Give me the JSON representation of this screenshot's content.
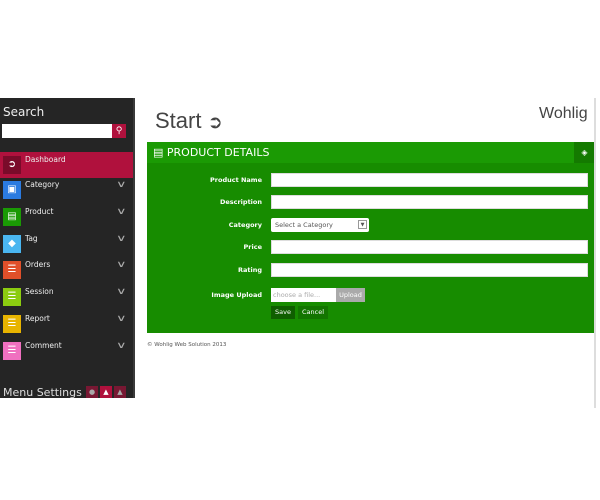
{
  "sidebar": {
    "search_label": "Search",
    "search_placeholder": "",
    "items": [
      {
        "label": "Dashboard",
        "icon": "arrow-circle-icon",
        "color": "#7a0b2a",
        "active": true
      },
      {
        "label": "Category",
        "icon": "cube-icon",
        "color": "#2b7be0"
      },
      {
        "label": "Product",
        "icon": "list-icon",
        "color": "#1a9a04"
      },
      {
        "label": "Tag",
        "icon": "tag-icon",
        "color": "#4ab6f0"
      },
      {
        "label": "Orders",
        "icon": "stack-icon",
        "color": "#e0502a"
      },
      {
        "label": "Session",
        "icon": "stack-icon",
        "color": "#8ccc10"
      },
      {
        "label": "Report",
        "icon": "stack-icon",
        "color": "#e8b400"
      },
      {
        "label": "Comment",
        "icon": "stack-icon",
        "color": "#f070c0"
      }
    ],
    "menu_settings": "Menu Settings"
  },
  "header": {
    "title": "Start",
    "brand": "Wohlig"
  },
  "panel": {
    "title": "PRODUCT DETAILS",
    "fields": {
      "product_name": "Product Name",
      "description": "Description",
      "category": "Category",
      "category_value": "Select a Category",
      "price": "Price",
      "rating": "Rating",
      "image_upload": "Image Upload",
      "file_placeholder": "choose a file...",
      "upload": "Upload"
    },
    "save": "Save",
    "cancel": "Cancel"
  },
  "footer": "© Wohlig Web Solution 2013"
}
